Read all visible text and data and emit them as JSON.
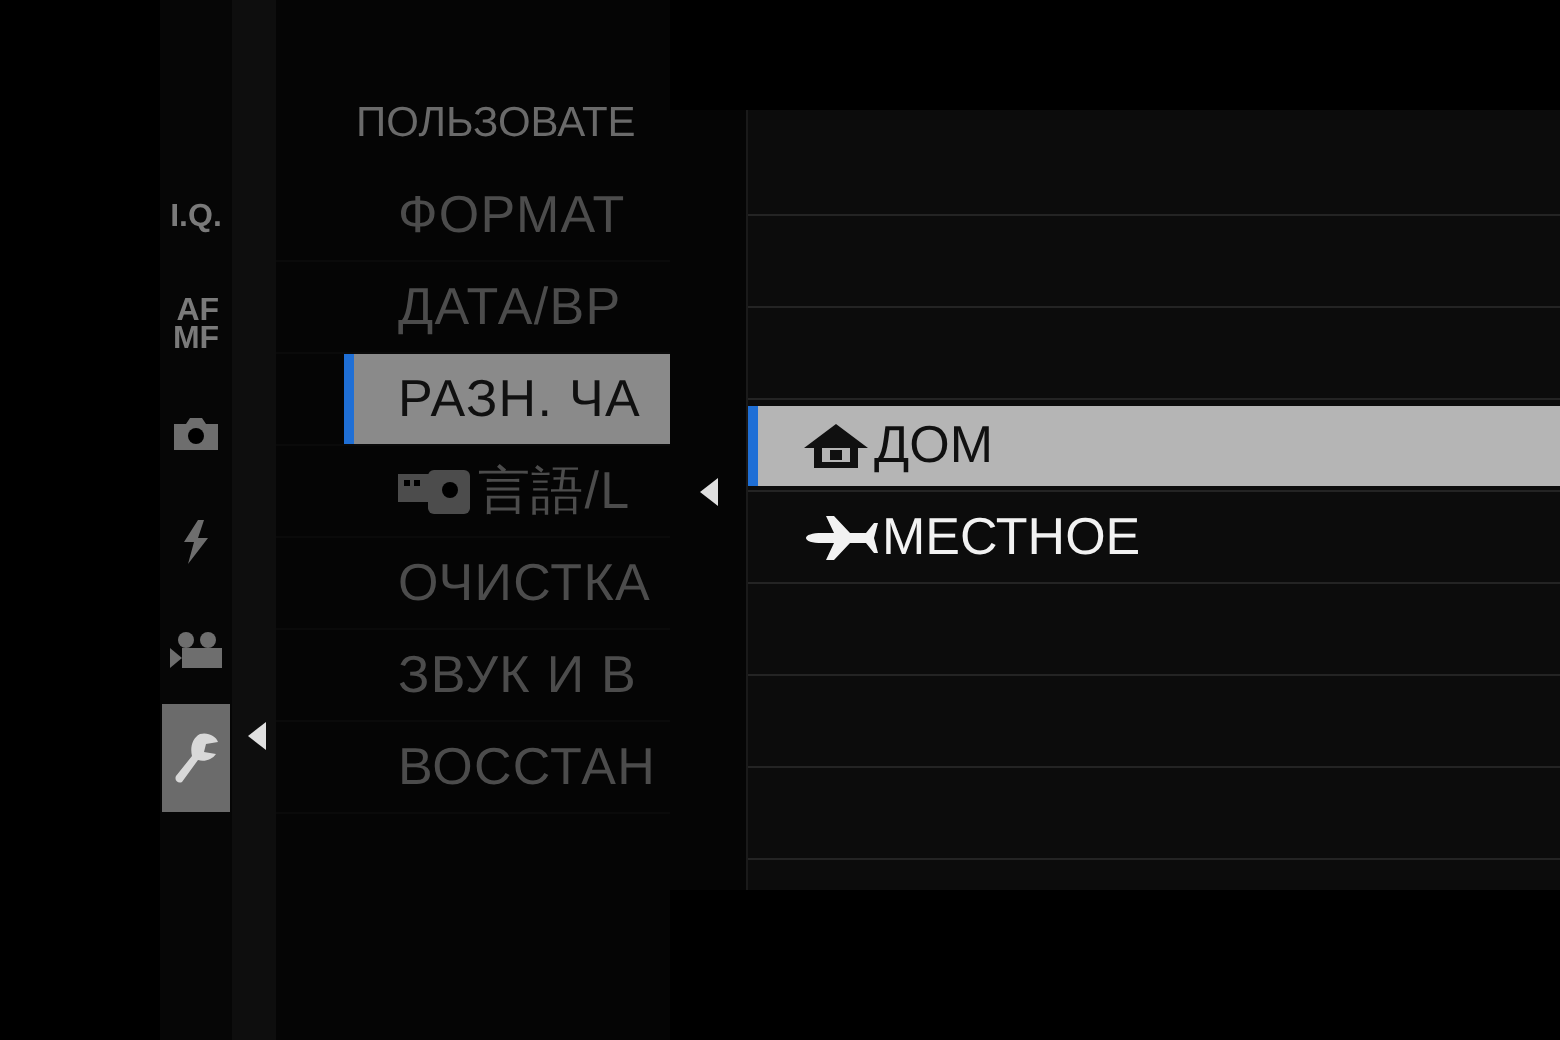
{
  "header": {
    "title": "ПОЛЬЗОВАТЕ"
  },
  "sidebar": {
    "items": [
      {
        "kind": "text",
        "lines": [
          "I.Q."
        ],
        "selected": false
      },
      {
        "kind": "text",
        "lines": [
          "AF",
          "MF"
        ],
        "selected": false
      },
      {
        "kind": "camera",
        "selected": false
      },
      {
        "kind": "flash",
        "selected": false
      },
      {
        "kind": "movie",
        "selected": false
      },
      {
        "kind": "setup",
        "selected": true
      }
    ]
  },
  "menu": {
    "rows": [
      {
        "kind": "text",
        "label": "ФОРМАТ",
        "selected": false
      },
      {
        "kind": "text",
        "label": "ДАТА/ВР",
        "selected": false
      },
      {
        "kind": "text",
        "label": "РАЗН. ЧА",
        "selected": true
      },
      {
        "kind": "language",
        "label": "言語/L",
        "selected": false
      },
      {
        "kind": "text",
        "label": "ОЧИСТКА",
        "selected": false
      },
      {
        "kind": "text",
        "label": "ЗВУК И В",
        "selected": false
      },
      {
        "kind": "text",
        "label": "ВОССТАН",
        "selected": false
      }
    ]
  },
  "popup": {
    "options": [
      {
        "kind": "home",
        "label": "ДОМ",
        "selected": true
      },
      {
        "kind": "plane",
        "label": "МЕСТНОЕ",
        "selected": false
      }
    ]
  }
}
